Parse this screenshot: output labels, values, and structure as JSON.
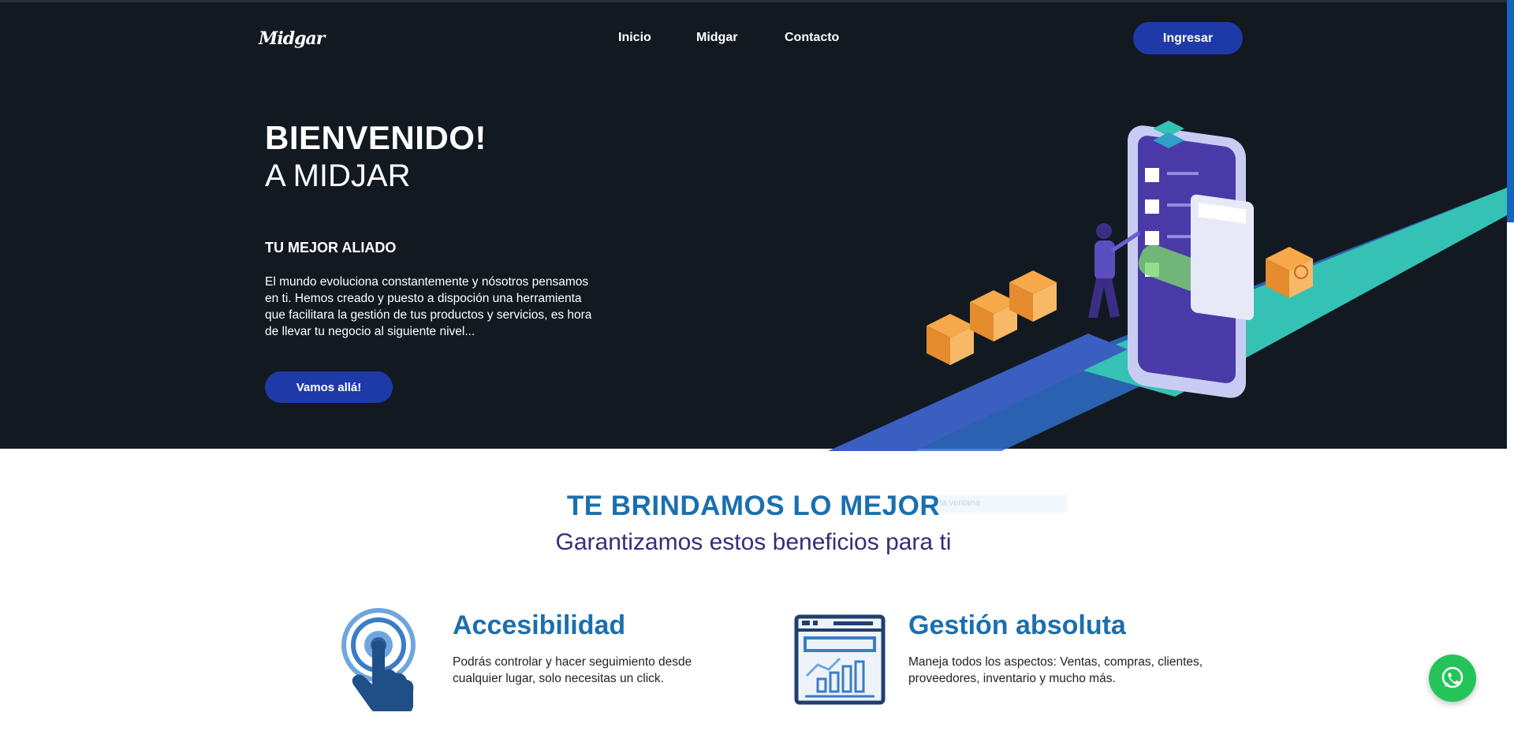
{
  "header": {
    "logo_text": "Midgar",
    "nav": [
      "Inicio",
      "Midgar",
      "Contacto"
    ],
    "login_label": "Ingresar"
  },
  "hero": {
    "title": "BIENVENIDO!",
    "subtitle": "A MIDJAR",
    "tagline": "TU MEJOR ALIADO",
    "description": "El mundo evoluciona constantemente y nósotros pensamos en ti. Hemos creado y puesto a dispoción una herramienta que facilitara la gestión de tus productos y servicios, es hora de llevar tu negocio al siguiente nivel...",
    "cta_label": "Vamos allá!"
  },
  "benefits": {
    "title": "TE BRINDAMOS LO MEJOR",
    "ghost_text": "la ventana",
    "subtitle": "Garantizamos estos beneficios para ti",
    "items": [
      {
        "icon": "touch-icon",
        "title": "Accesibilidad",
        "description": "Podrás controlar y hacer seguimiento desde cualquier lugar, solo necesitas un click."
      },
      {
        "icon": "dashboard-icon",
        "title": "Gestión absoluta",
        "description": "Maneja todos los aspectos: Ventas, compras, clientes, proveedores, inventario y mucho más."
      }
    ]
  },
  "colors": {
    "hero_bg": "#121921",
    "button": "#1e3aa8",
    "heading_blue": "#1b6fae",
    "subtitle_purple": "#3a2a7a",
    "whatsapp": "#25c45a"
  },
  "floating": {
    "icon": "whatsapp-icon"
  }
}
